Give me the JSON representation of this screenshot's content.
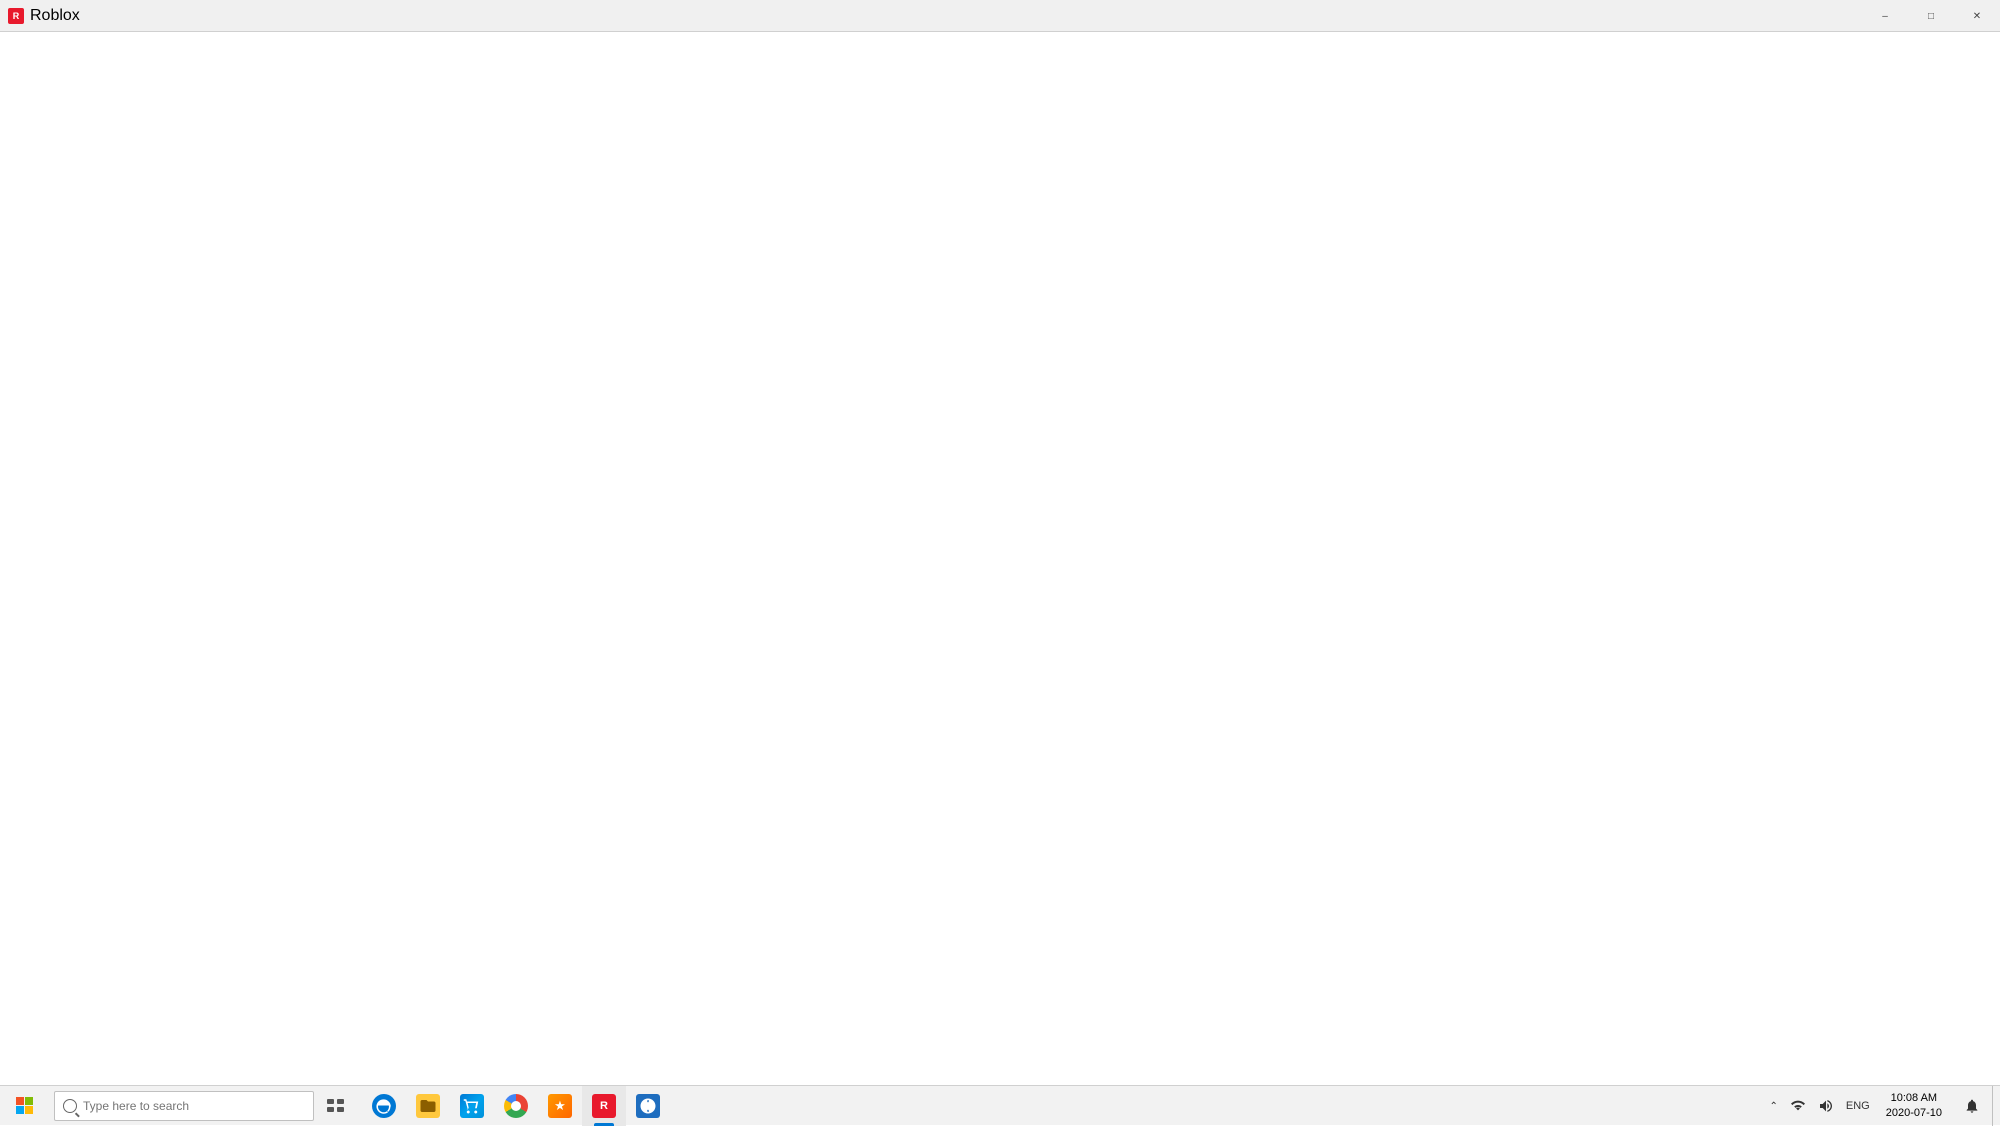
{
  "titlebar": {
    "title": "Roblox",
    "icon_label": "roblox-icon"
  },
  "main_content": {
    "background": "#ffffff"
  },
  "taskbar": {
    "search_placeholder": "Type here to search",
    "time": "10:08 AM",
    "date": "2020-07-10",
    "language": "ENG",
    "pinned_apps": [
      {
        "id": "file-explorer",
        "label": "File Explorer"
      },
      {
        "id": "cortana",
        "label": "Cortana"
      },
      {
        "id": "task-view",
        "label": "Task View"
      },
      {
        "id": "edge",
        "label": "Microsoft Edge"
      },
      {
        "id": "file-manager",
        "label": "File Manager"
      },
      {
        "id": "store",
        "label": "Microsoft Store"
      },
      {
        "id": "chrome",
        "label": "Google Chrome"
      },
      {
        "id": "star-app",
        "label": "Favorites"
      },
      {
        "id": "roblox",
        "label": "Roblox"
      },
      {
        "id": "blue-app",
        "label": "App"
      }
    ],
    "tray_icons": [
      "chevron",
      "network",
      "volume",
      "eng",
      "clock",
      "notification"
    ],
    "minimize_label": "Minimize",
    "restore_label": "Restore",
    "close_label": "Close"
  }
}
